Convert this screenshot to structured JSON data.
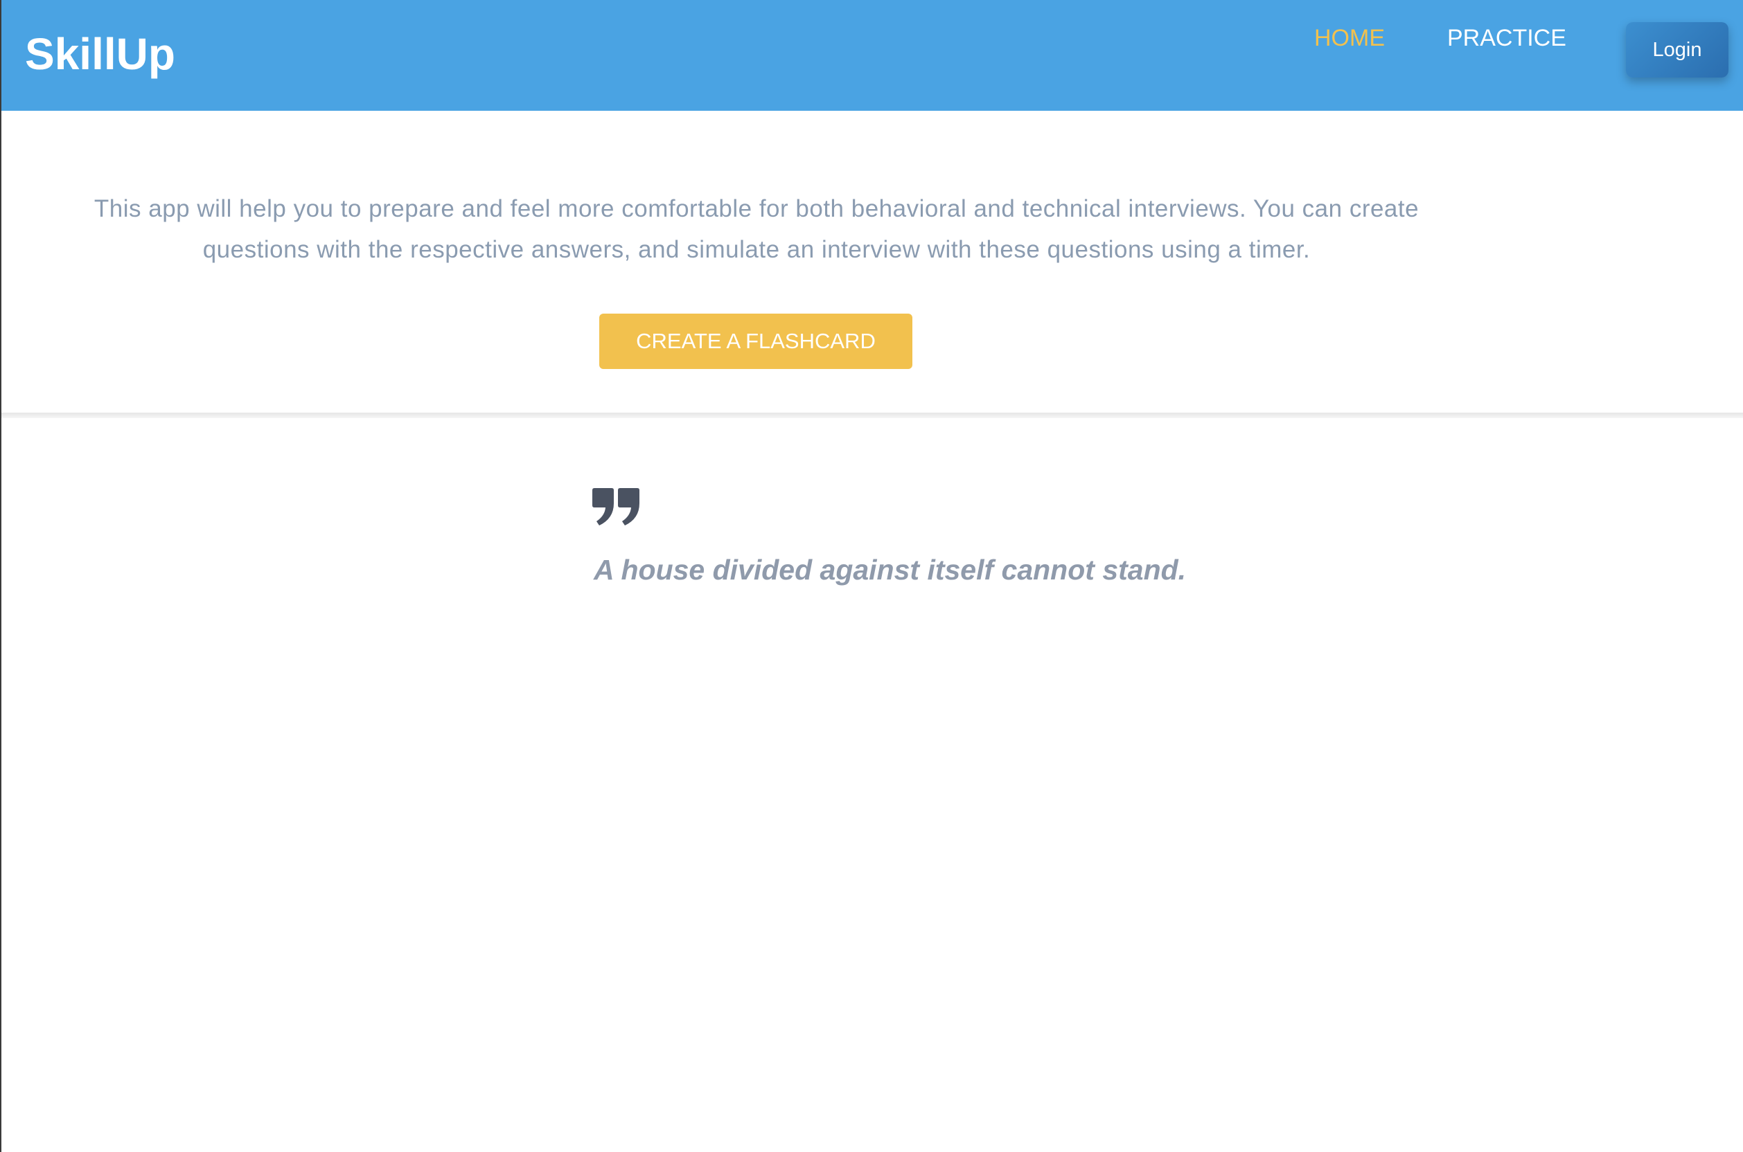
{
  "header": {
    "brand": "SkillUp",
    "nav": {
      "home": "HOME",
      "practice": "PRACTICE"
    },
    "login_label": "Login"
  },
  "intro": {
    "description": "This app will help you to prepare and feel more comfortable for both behavioral and technical interviews. You can create questions with the respective answers, and simulate an interview with these questions using a timer.",
    "create_button_label": "CREATE A FLASHCARD"
  },
  "quote": {
    "icon": "quote-icon",
    "text": "A house divided against itself cannot stand."
  },
  "colors": {
    "header_bg": "#4aa3e3",
    "accent": "#f2c14e",
    "muted_text": "#8a9bb0",
    "quote_icon": "#4a5261"
  }
}
